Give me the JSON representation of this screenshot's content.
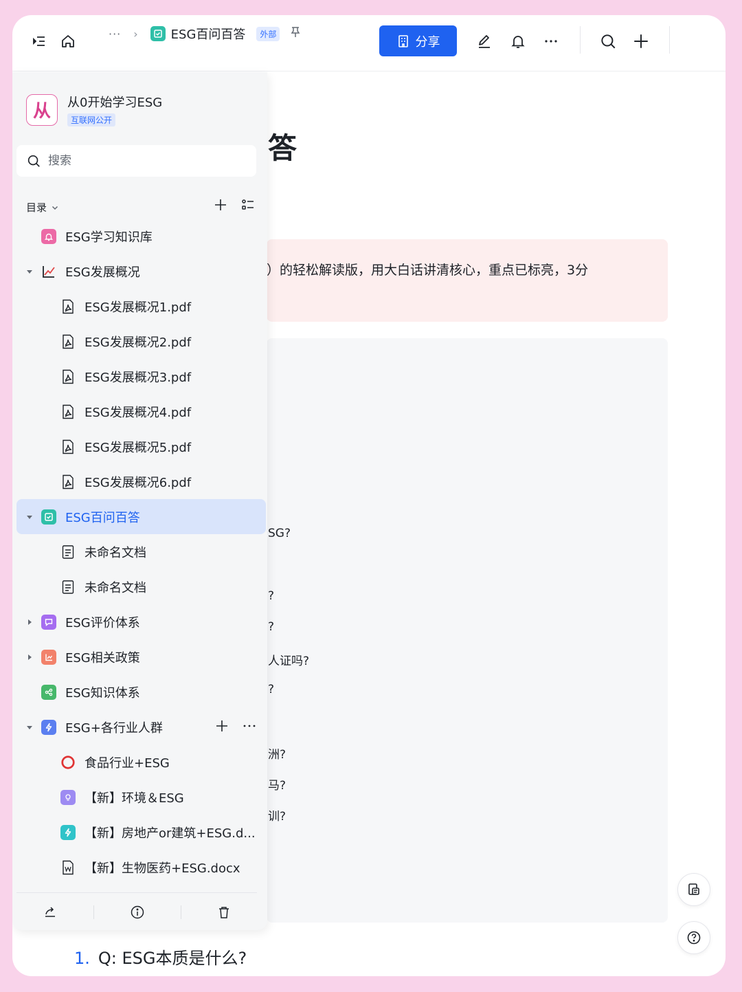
{
  "topbar": {
    "breadcrumb_more": "···",
    "breadcrumb_sep": "›",
    "doc_title": "ESG百问百答",
    "external_badge": "外部",
    "share_label": "分享"
  },
  "document": {
    "heading_fragment": "答",
    "callout_text": "）的轻松解读版，用大白话讲清核心，重点已标亮，3分",
    "fragments": [
      "SG?",
      "?",
      "?",
      "人证吗?",
      "?",
      "洲?",
      "马?",
      "训?"
    ],
    "first_question_num": "1.",
    "first_question": "Q: ESG本质是什么?"
  },
  "sidebar": {
    "kb_name": "从0开始学习ESG",
    "kb_logo_text": "从",
    "kb_badge": "互联网公开",
    "search_placeholder": "搜索",
    "toc_label": "目录",
    "items": [
      {
        "label": "ESG学习知识库",
        "icon": "bell-icon",
        "color": "#ec6aa6"
      },
      {
        "label": "ESG发展概况",
        "icon": "chart-icon",
        "color": "#e04848"
      },
      {
        "label": "ESG发展概况1.pdf",
        "icon": "pdf-icon"
      },
      {
        "label": "ESG发展概况2.pdf",
        "icon": "pdf-icon"
      },
      {
        "label": "ESG发展概况3.pdf",
        "icon": "pdf-icon"
      },
      {
        "label": "ESG发展概况4.pdf",
        "icon": "pdf-icon"
      },
      {
        "label": "ESG发展概况5.pdf",
        "icon": "pdf-icon"
      },
      {
        "label": "ESG发展概况6.pdf",
        "icon": "pdf-icon"
      },
      {
        "label": "ESG百问百答",
        "icon": "checkbox-icon",
        "color": "#2fbfa8"
      },
      {
        "label": "未命名文档",
        "icon": "doc-icon"
      },
      {
        "label": "未命名文档",
        "icon": "doc-icon"
      },
      {
        "label": "ESG评价体系",
        "icon": "chat-icon",
        "color": "#a56df0"
      },
      {
        "label": "ESG相关政策",
        "icon": "chart-icon",
        "color": "#f2826b"
      },
      {
        "label": "ESG知识体系",
        "icon": "share-icon",
        "color": "#47b86b"
      },
      {
        "label": "ESG+各行业人群",
        "icon": "bolt-icon",
        "color": "#5b7ff0"
      },
      {
        "label": "食品行业+ESG",
        "icon": "ring-icon",
        "color": "#e03434"
      },
      {
        "label": "【新】环境＆ESG",
        "icon": "bulb-icon",
        "color": "#9d8bf2"
      },
      {
        "label": "【新】房地产or建筑+ESG.d...",
        "icon": "bolt-icon",
        "color": "#2fc3c9"
      },
      {
        "label": "【新】生物医药+ESG.docx",
        "icon": "word-icon"
      }
    ]
  },
  "colors": {
    "accent": "#1f62f0",
    "selected_bg": "#d9e4fb",
    "page_bg": "#f9d3ea",
    "callout_bg": "#fdeeee"
  }
}
